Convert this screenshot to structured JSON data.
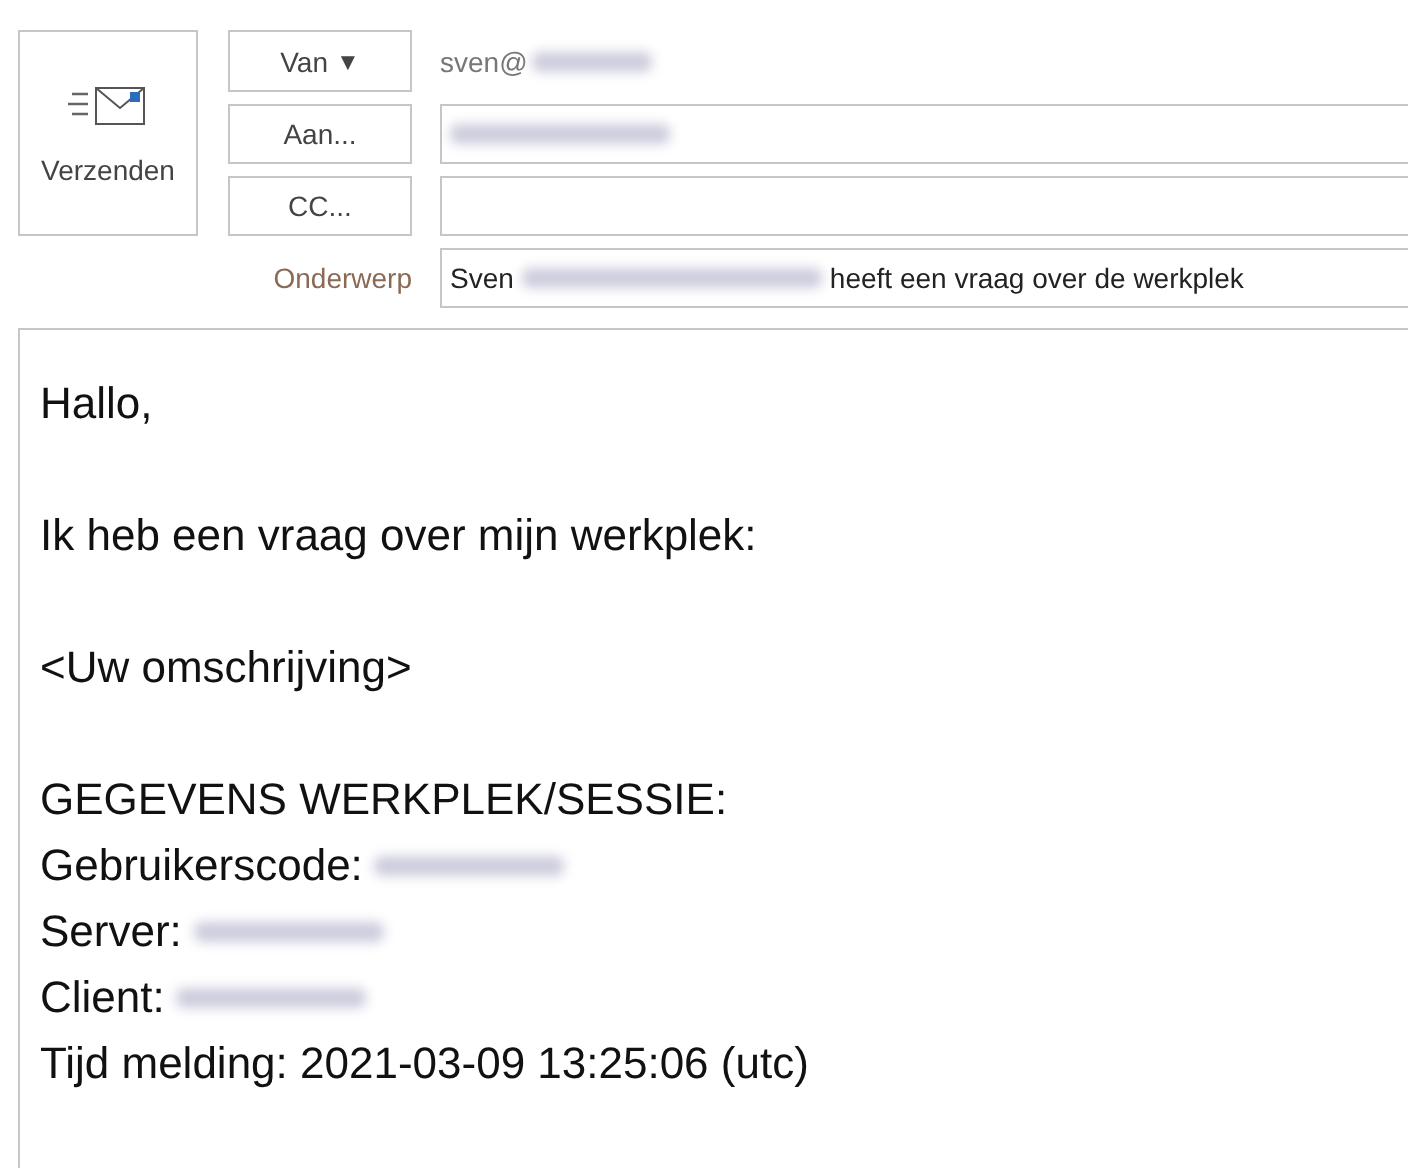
{
  "send_button": {
    "label": "Verzenden"
  },
  "from": {
    "button": "Van",
    "caret": "▼",
    "value": "sven@"
  },
  "to": {
    "button": "Aan..."
  },
  "cc": {
    "button": "CC..."
  },
  "subject": {
    "label": "Onderwerp",
    "before": "Sven",
    "after": "heeft een vraag over de werkplek"
  },
  "body": [
    {
      "kind": "text",
      "text": "Hallo,"
    },
    {
      "kind": "blank"
    },
    {
      "kind": "text",
      "text": "Ik heb een vraag over mijn werkplek:"
    },
    {
      "kind": "blank"
    },
    {
      "kind": "text",
      "text": "<Uw omschrijving>"
    },
    {
      "kind": "blank"
    },
    {
      "kind": "text",
      "text": "GEGEVENS WERKPLEK/SESSIE:"
    },
    {
      "kind": "redacted",
      "text": "Gebruikerscode:"
    },
    {
      "kind": "redacted",
      "text": "Server:"
    },
    {
      "kind": "redacted",
      "text": "Client:"
    },
    {
      "kind": "text",
      "text": "Tijd melding: 2021-03-09 13:25:06 (utc)"
    }
  ]
}
